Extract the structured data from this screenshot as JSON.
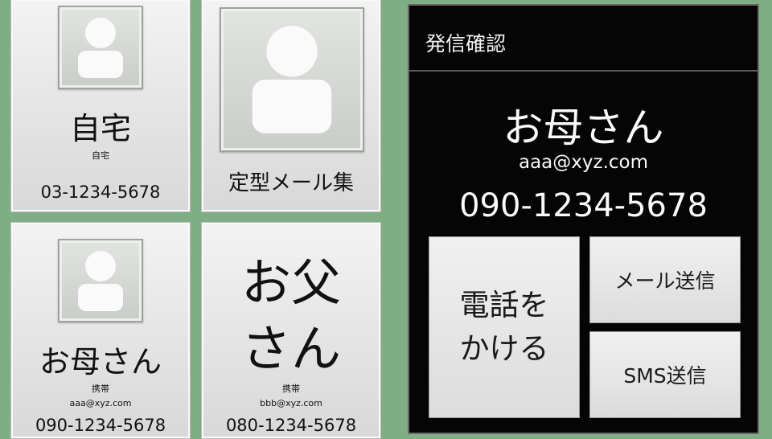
{
  "tiles": [
    {
      "title": "自宅",
      "subtitle": "自宅",
      "email": "",
      "phone": "03-1234-5678"
    },
    {
      "title": "定型メール集"
    },
    {
      "title": "お母さん",
      "subtitle": "携帯",
      "email": "aaa@xyz.com",
      "phone": "090-1234-5678"
    },
    {
      "title_line1": "お父",
      "title_line2": "さん",
      "subtitle": "携帯",
      "email": "bbb@xyz.com",
      "phone": "080-1234-5678"
    }
  ],
  "dialog": {
    "title": "発信確認",
    "name": "お母さん",
    "email": "aaa@xyz.com",
    "phone": "090-1234-5678",
    "call_line1": "電話を",
    "call_line2": "かける",
    "mail_button": "メール送信",
    "sms_button": "SMS送信"
  }
}
